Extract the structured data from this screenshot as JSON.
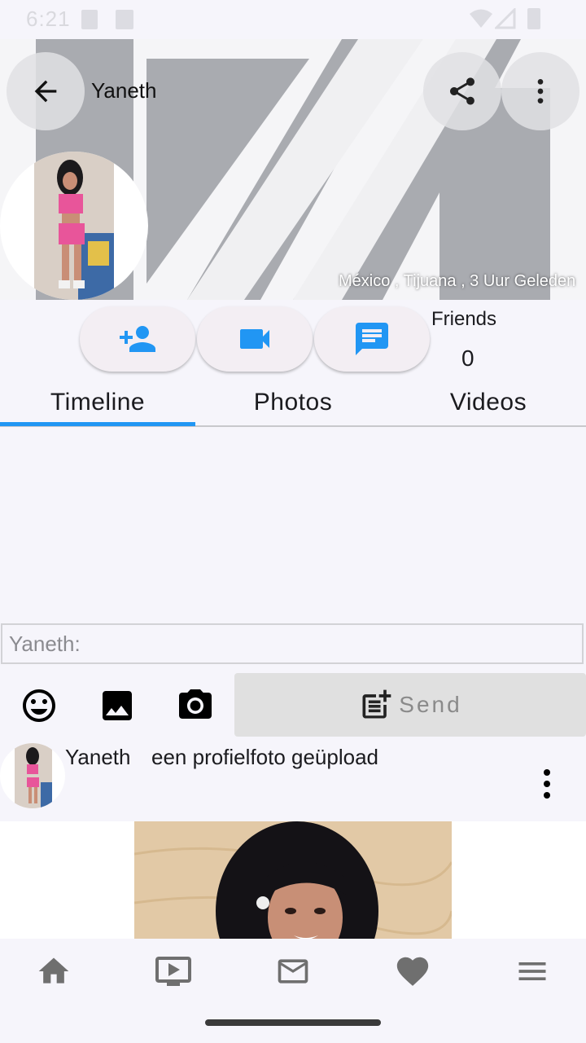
{
  "status_bar": {
    "time": "6:21"
  },
  "profile": {
    "name": "Yaneth",
    "location": "México , Tijuana , 3 Uur Geleden"
  },
  "friends": {
    "label": "Friends",
    "count": "0"
  },
  "tabs": [
    {
      "label": "Timeline",
      "active": true
    },
    {
      "label": "Photos",
      "active": false
    },
    {
      "label": "Videos",
      "active": false
    }
  ],
  "composer": {
    "placeholder": "Yaneth:",
    "send_label": "Send"
  },
  "post": {
    "author": "Yaneth",
    "action": "een profielfoto geüpload"
  },
  "icons": {
    "back": "arrow-left-icon",
    "share": "share-icon",
    "more": "more-vert-icon",
    "add_friend": "person-add-icon",
    "video_call": "videocam-icon",
    "message": "chat-icon",
    "emoji": "emoji-icon",
    "image": "image-icon",
    "camera": "camera-icon",
    "post_add": "post-add-icon",
    "nav": [
      "home-icon",
      "video-library-icon",
      "mail-icon",
      "heart-icon",
      "menu-icon"
    ]
  },
  "colors": {
    "accent": "#2196f3",
    "background": "#f6f5fb",
    "nav_icon": "#6f6f6f"
  }
}
